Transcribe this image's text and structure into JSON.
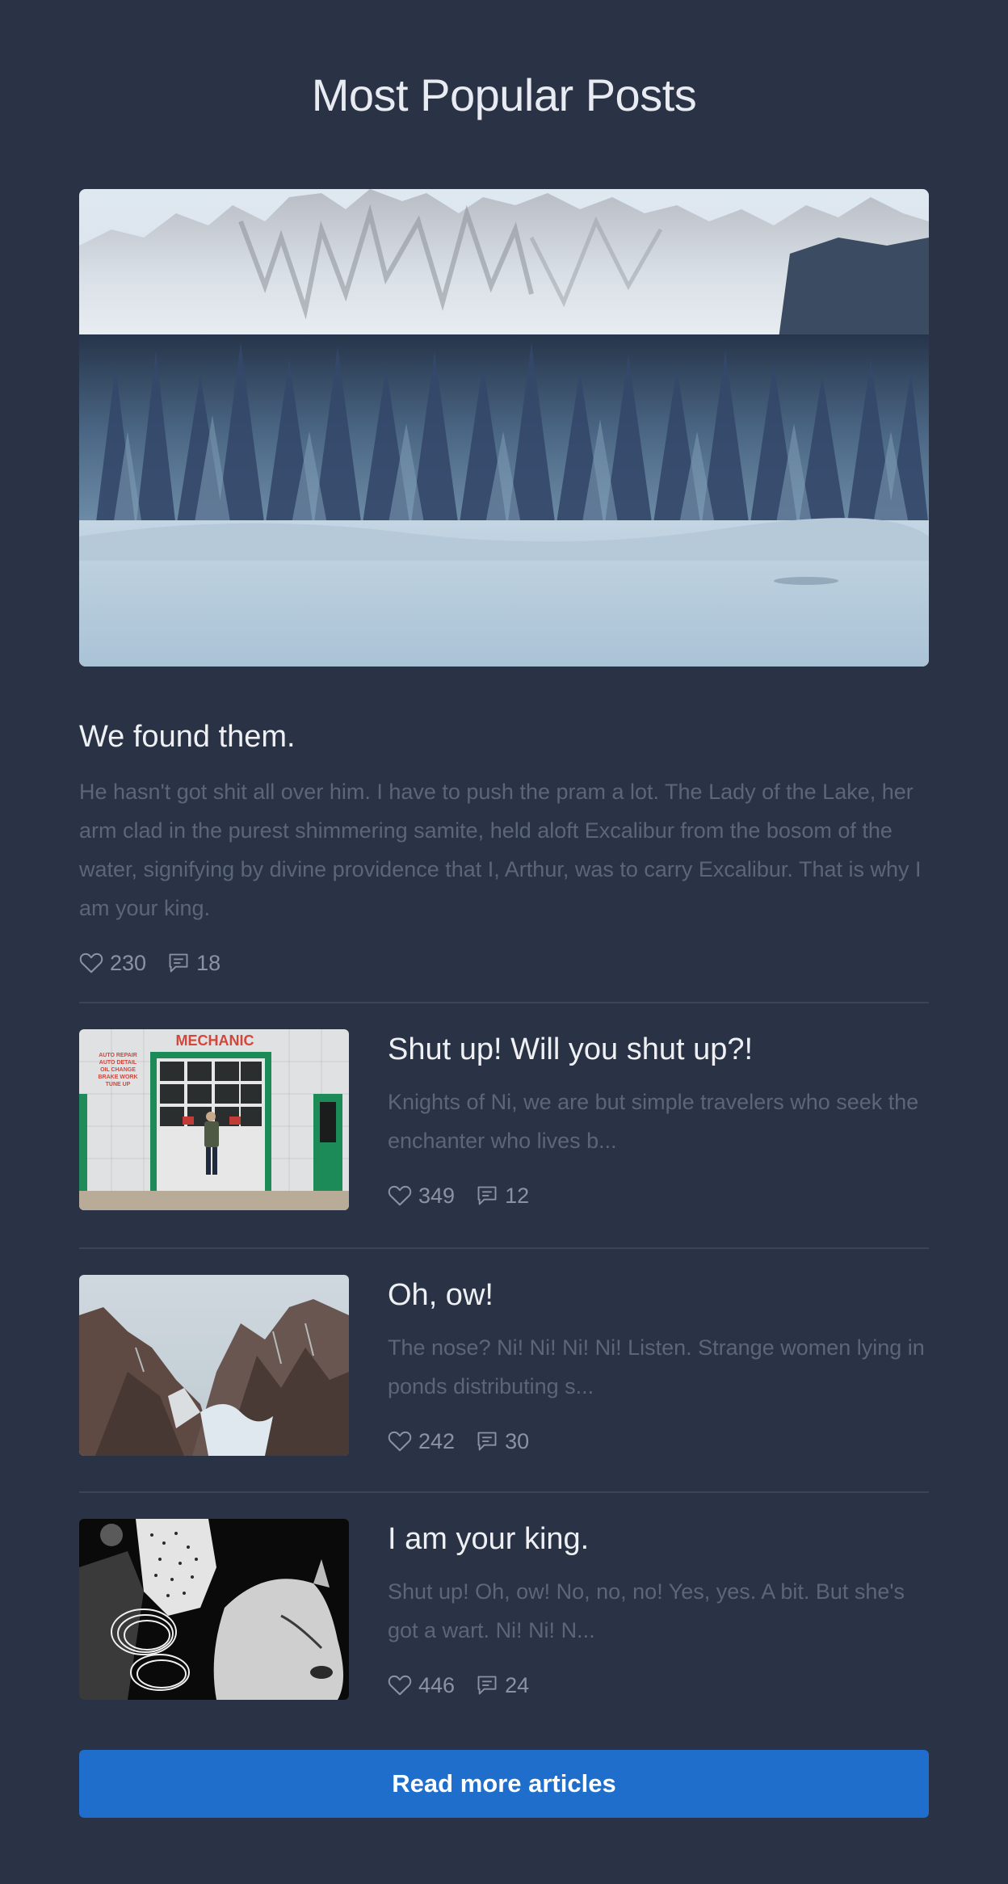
{
  "page": {
    "title": "Most Popular Posts"
  },
  "featured": {
    "title": "We found them.",
    "excerpt": "He hasn't got shit all over him. I have to push the pram a lot. The Lady of the Lake, her arm clad in the purest shimmering samite, held aloft Excalibur from the bosom of the water, signifying by divine providence that I, Arthur, was to carry Excalibur. That is why I am your king.",
    "likes": "230",
    "comments": "18"
  },
  "posts": [
    {
      "title": "Shut up! Will you shut up?!",
      "excerpt": "Knights of Ni, we are but simple travelers who seek the enchanter who lives b...",
      "likes": "349",
      "comments": "12",
      "image_sign": "MECHANIC",
      "image_sign_lines": [
        "AUTO REPAIR",
        "AUTO DETAIL",
        "OIL CHANGE",
        "BRAKE WORK",
        "TUNE UP"
      ]
    },
    {
      "title": "Oh, ow!",
      "excerpt": "The nose? Ni! Ni! Ni! Ni! Listen. Strange women lying in ponds distributing s...",
      "likes": "242",
      "comments": "30"
    },
    {
      "title": "I am your king.",
      "excerpt": "Shut up! Oh, ow! No, no, no! Yes, yes. A bit. But she's got a wart. Ni! Ni! N...",
      "likes": "446",
      "comments": "24"
    }
  ],
  "cta": {
    "label": "Read more articles"
  },
  "icons": {
    "like": "heart-icon",
    "comment": "comment-icon"
  },
  "colors": {
    "background": "#2a3245",
    "button": "#1f6ecb",
    "excerpt": "#5c6679",
    "meta": "#8b93a3"
  }
}
